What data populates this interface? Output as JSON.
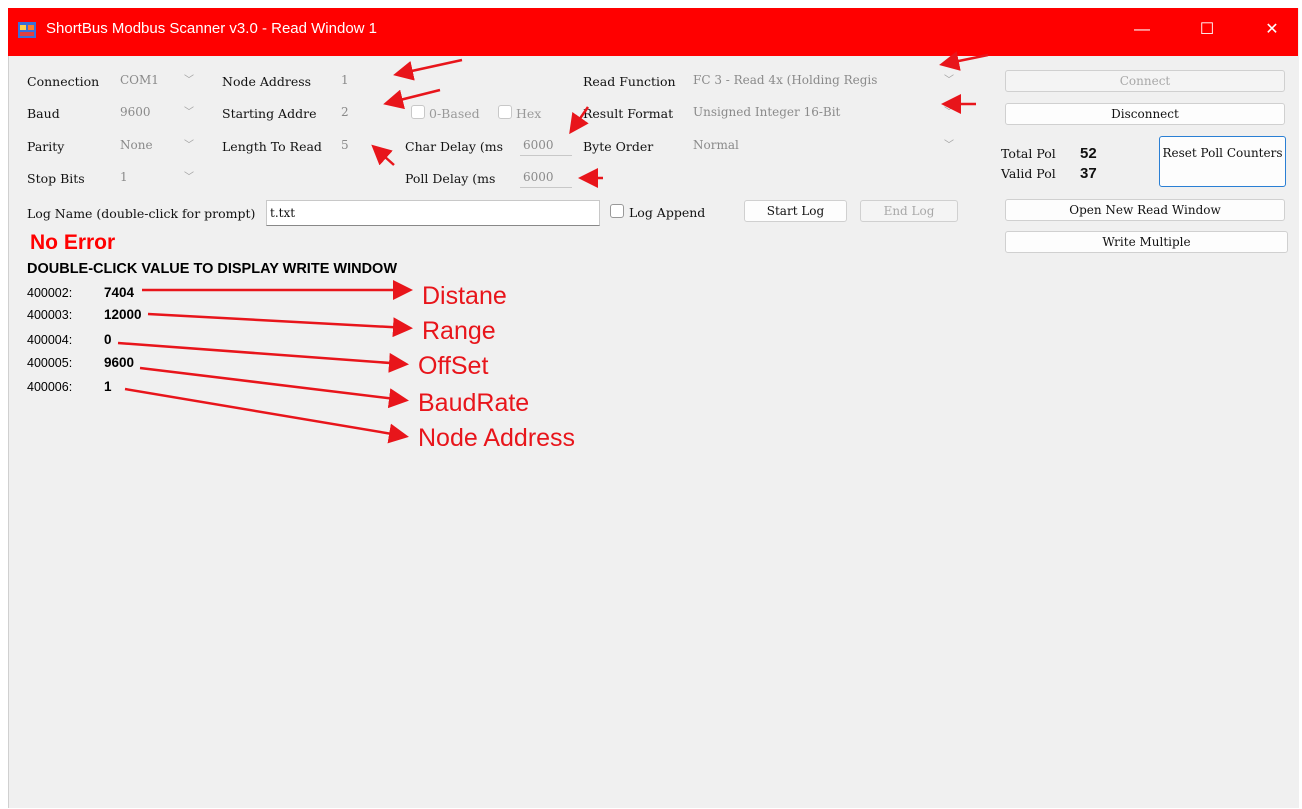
{
  "window": {
    "title": "ShortBus Modbus Scanner v3.0 - Read Window 1",
    "controls": {
      "minimize": "—",
      "maximize": "☐",
      "close": "✕"
    },
    "title_bar_color": "#ff0000"
  },
  "settings": {
    "connection": {
      "label": "Connection",
      "value": "COM1"
    },
    "baud": {
      "label": "Baud",
      "value": "9600"
    },
    "parity": {
      "label": "Parity",
      "value": "None"
    },
    "stop_bits": {
      "label": "Stop Bits",
      "value": "1"
    },
    "node_address": {
      "label": "Node Address",
      "value": "1"
    },
    "starting_address": {
      "label": "Starting Addre",
      "value": "2"
    },
    "length_to_read": {
      "label": "Length To Read",
      "value": "5"
    },
    "zero_based": {
      "label": "0-Based"
    },
    "hex": {
      "label": "Hex"
    },
    "char_delay": {
      "label": "Char Delay (ms",
      "value": "6000"
    },
    "poll_delay": {
      "label": "Poll Delay (ms",
      "value": "6000"
    },
    "read_function": {
      "label": "Read Function",
      "value": "FC 3 - Read 4x (Holding Regis"
    },
    "result_format": {
      "label": "Result Format",
      "value": "Unsigned Integer 16-Bit"
    },
    "byte_order": {
      "label": "Byte Order",
      "value": "Normal"
    }
  },
  "log": {
    "label": "Log Name (double-click for prompt)",
    "value": "t.txt",
    "append_label": "Log Append",
    "start_label": "Start Log",
    "end_label": "End Log"
  },
  "buttons": {
    "connect": "Connect",
    "disconnect": "Disconnect",
    "reset_poll": "Reset Poll Counters",
    "open_new_read": "Open New Read Window",
    "write_multiple": "Write Multiple"
  },
  "counters": {
    "total_label": "Total Pol",
    "total_value": "52",
    "valid_label": "Valid Pol",
    "valid_value": "37"
  },
  "status": {
    "text": "No Error",
    "color": "#ff0000",
    "hint": "DOUBLE-CLICK VALUE TO DISPLAY WRITE WINDOW"
  },
  "registers": [
    {
      "address": "400002:",
      "value": "7404",
      "annotation": "Distane"
    },
    {
      "address": "400003:",
      "value": "12000",
      "annotation": "Range"
    },
    {
      "address": "400004:",
      "value": "0",
      "annotation": "OffSet"
    },
    {
      "address": "400005:",
      "value": "9600",
      "annotation": "BaudRate"
    },
    {
      "address": "400006:",
      "value": "1",
      "annotation": "Node Address"
    }
  ],
  "annotation_color": "#e8151b"
}
